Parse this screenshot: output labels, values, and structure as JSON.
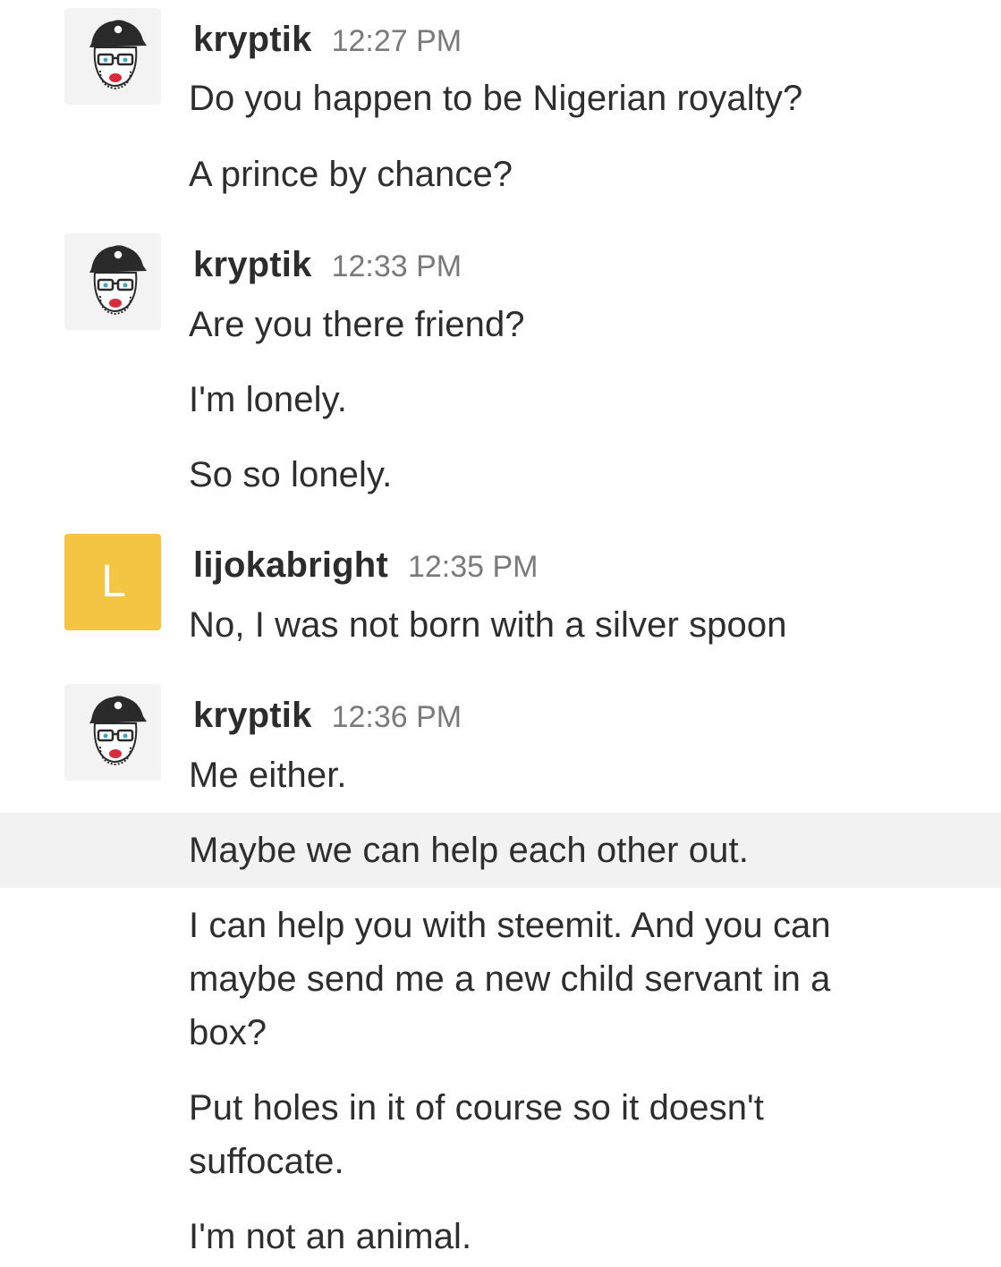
{
  "messages": [
    {
      "user": "kryptik",
      "time": "12:27 PM",
      "lines": [
        "Do you happen to be Nigerian royalty?",
        "A prince by chance?"
      ]
    },
    {
      "user": "kryptik",
      "time": "12:33 PM",
      "lines": [
        "Are you there friend?",
        "I'm lonely.",
        "So so lonely."
      ]
    },
    {
      "user": "lijokabright",
      "avatar_letter": "L",
      "avatar_color": "#f4c542",
      "time": "12:35 PM",
      "lines": [
        "No, I was not born with a silver spoon"
      ]
    },
    {
      "user": "kryptik",
      "time": "12:36 PM",
      "lines": [
        "Me either.",
        "Maybe we can help each other out.",
        "I can help you with steemit. And you can maybe send me a new child servant in a box?",
        "Put holes in it of course so it doesn't suffocate.",
        "I'm not an animal."
      ]
    }
  ],
  "icons": {
    "kryptik_avatar": "cartoon-face-avatar-icon"
  }
}
